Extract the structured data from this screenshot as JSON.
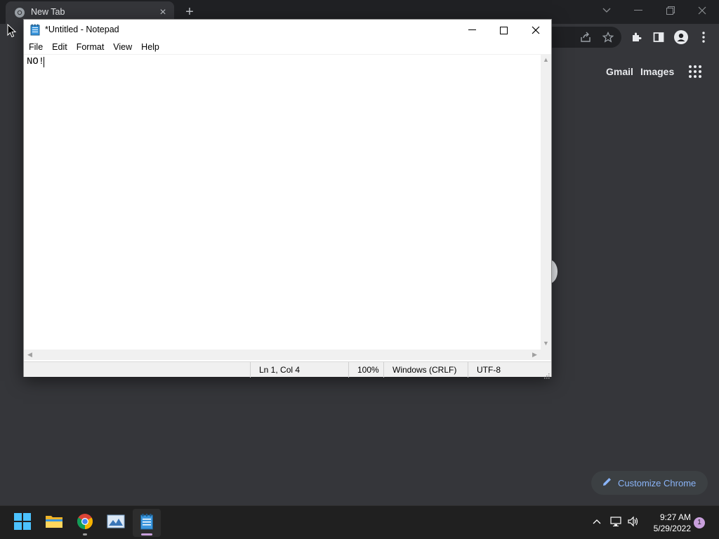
{
  "chrome": {
    "tab_title": "New Tab",
    "links": {
      "gmail": "Gmail",
      "images": "Images"
    },
    "customize_label": "Customize Chrome"
  },
  "notepad": {
    "title": "*Untitled - Notepad",
    "menu": [
      "File",
      "Edit",
      "Format",
      "View",
      "Help"
    ],
    "content": "NO!",
    "status": {
      "position": "Ln 1, Col 4",
      "zoom": "100%",
      "line_ending": "Windows (CRLF)",
      "encoding": "UTF-8"
    }
  },
  "taskbar": {
    "apps": [
      "start-icon",
      "file-explorer-icon",
      "chrome-icon",
      "photos-icon",
      "notepad-icon"
    ],
    "time": "9:27 AM",
    "date": "5/29/2022",
    "notification_count": "1"
  },
  "colors": {
    "chrome_bg": "#35363a",
    "chrome_accent": "#8ab4f8",
    "taskbar_bg": "#202020",
    "notepad_bg": "#ffffff"
  }
}
